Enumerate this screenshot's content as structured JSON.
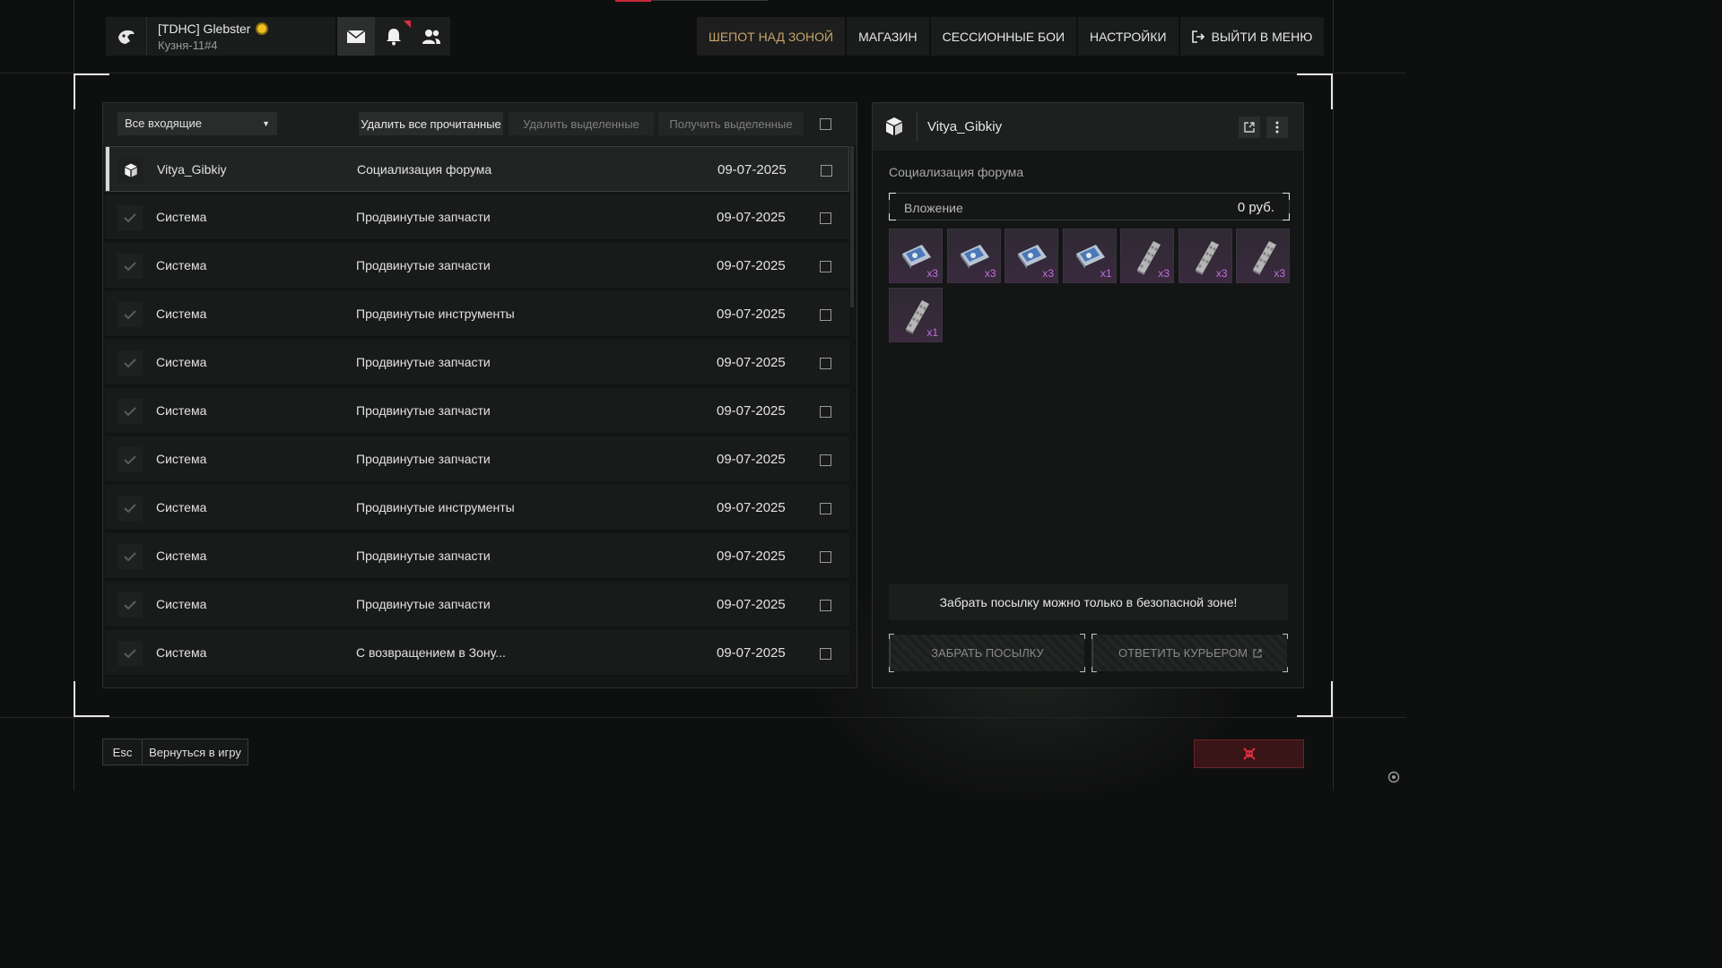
{
  "profile": {
    "name": "[TDHC] Glebster",
    "subtitle": "Кузня-11#4"
  },
  "nav": {
    "items": [
      {
        "label": "ШЕПОТ НАД ЗОНОЙ",
        "active": true
      },
      {
        "label": "МАГАЗИН"
      },
      {
        "label": "СЕССИОННЫЕ БОИ"
      },
      {
        "label": "НАСТРОЙКИ"
      },
      {
        "label": "ВЫЙТИ В МЕНЮ",
        "icon": "exit-icon"
      }
    ]
  },
  "toolbar": {
    "filter_value": "Все входящие",
    "delete_read": "Удалить все прочитанные",
    "delete_selected": "Удалить выделенные",
    "receive_selected": "Получить выделенные"
  },
  "mails": [
    {
      "sender": "Vitya_Gibkiy",
      "subject": "Социализация форума",
      "date": "09-07-2025",
      "icon": "package-icon",
      "selected": true
    },
    {
      "sender": "Система",
      "subject": "Продвинутые запчасти",
      "date": "09-07-2025",
      "icon": "check-icon"
    },
    {
      "sender": "Система",
      "subject": "Продвинутые запчасти",
      "date": "09-07-2025",
      "icon": "check-icon"
    },
    {
      "sender": "Система",
      "subject": "Продвинутые инструменты",
      "date": "09-07-2025",
      "icon": "check-icon"
    },
    {
      "sender": "Система",
      "subject": "Продвинутые запчасти",
      "date": "09-07-2025",
      "icon": "check-icon"
    },
    {
      "sender": "Система",
      "subject": "Продвинутые запчасти",
      "date": "09-07-2025",
      "icon": "check-icon"
    },
    {
      "sender": "Система",
      "subject": "Продвинутые запчасти",
      "date": "09-07-2025",
      "icon": "check-icon"
    },
    {
      "sender": "Система",
      "subject": "Продвинутые инструменты",
      "date": "09-07-2025",
      "icon": "check-icon"
    },
    {
      "sender": "Система",
      "subject": "Продвинутые запчасти",
      "date": "09-07-2025",
      "icon": "check-icon"
    },
    {
      "sender": "Система",
      "subject": "Продвинутые запчасти",
      "date": "09-07-2025",
      "icon": "check-icon"
    },
    {
      "sender": "Система",
      "subject": "С возвращением в Зону...",
      "date": "09-07-2025",
      "icon": "check-icon"
    }
  ],
  "detail": {
    "sender": "Vitya_Gibkiy",
    "subject": "Социализация форума",
    "attachment_label": "Вложение",
    "attachment_value": "0 руб.",
    "items": [
      {
        "kind": "toolkit",
        "qty": "x3"
      },
      {
        "kind": "toolkit",
        "qty": "x3"
      },
      {
        "kind": "toolkit",
        "qty": "x3"
      },
      {
        "kind": "toolkit",
        "qty": "x1"
      },
      {
        "kind": "plate",
        "qty": "x3"
      },
      {
        "kind": "plate",
        "qty": "x3"
      },
      {
        "kind": "plate",
        "qty": "x3"
      },
      {
        "kind": "plate",
        "qty": "x1"
      }
    ],
    "notice": "Забрать посылку можно только в безопасной зоне!",
    "take_button": "ЗАБРАТЬ ПОСЫЛКУ",
    "reply_button": "ОТВЕТИТЬ КУРЬЕРОМ"
  },
  "footer": {
    "esc_key": "Esc",
    "back_label": "Вернуться в игру"
  },
  "colors": {
    "accent_gold": "#c7a46b",
    "danger_red": "#c8283a",
    "item_qty": "#c070d8"
  }
}
